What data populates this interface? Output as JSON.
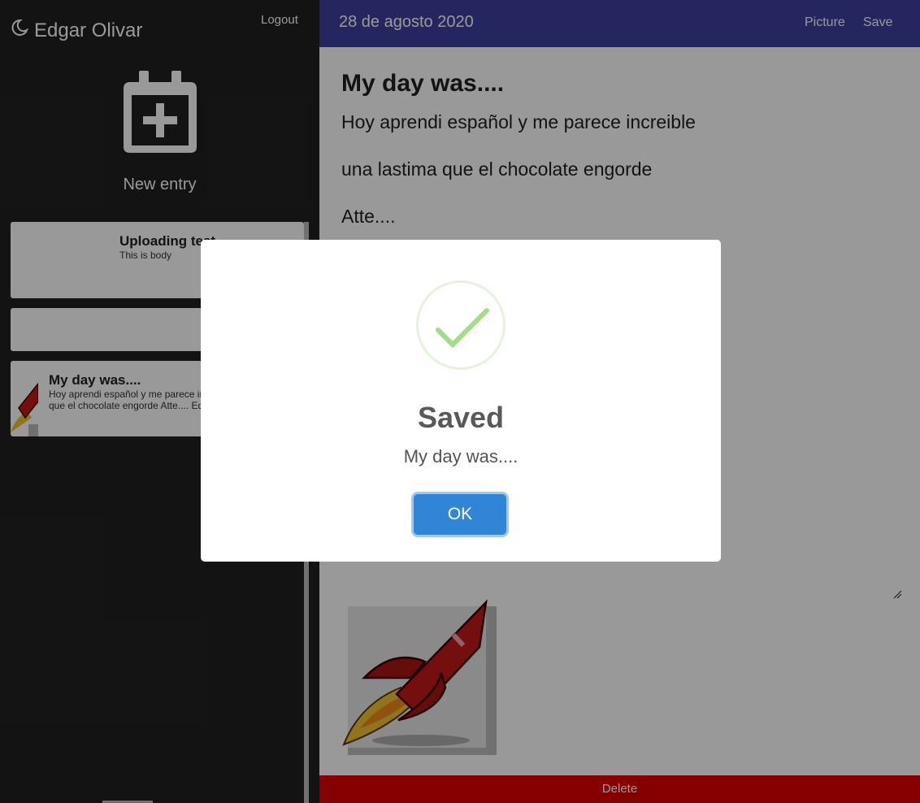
{
  "sidebar": {
    "user_name": "Edgar Olivar",
    "logout_label": "Logout",
    "new_entry_label": "New entry",
    "entries": [
      {
        "title": "Uploading test",
        "body": "This is body"
      },
      {
        "title": "",
        "body": ""
      },
      {
        "title": "My day was....",
        "body": "Hoy aprendi español y me parece increible una lastima que el chocolate engorde Atte.... Edgardo Guitierrez"
      }
    ]
  },
  "main": {
    "date": "28 de agosto 2020",
    "picture_label": "Picture",
    "save_label": "Save",
    "entry_title": "My day was....",
    "body_lines": [
      "Hoy aprendi español y me parece increible",
      "una lastima que el chocolate engorde",
      "Atte...."
    ],
    "delete_label": "Delete"
  },
  "modal": {
    "title": "Saved",
    "text": "My day was....",
    "ok_label": "OK"
  },
  "colors": {
    "topbar": "#3f3fa0",
    "sidebar": "#212121",
    "delete": "#e00000",
    "ok_button": "#3085d6",
    "success": "#a5dc86"
  }
}
